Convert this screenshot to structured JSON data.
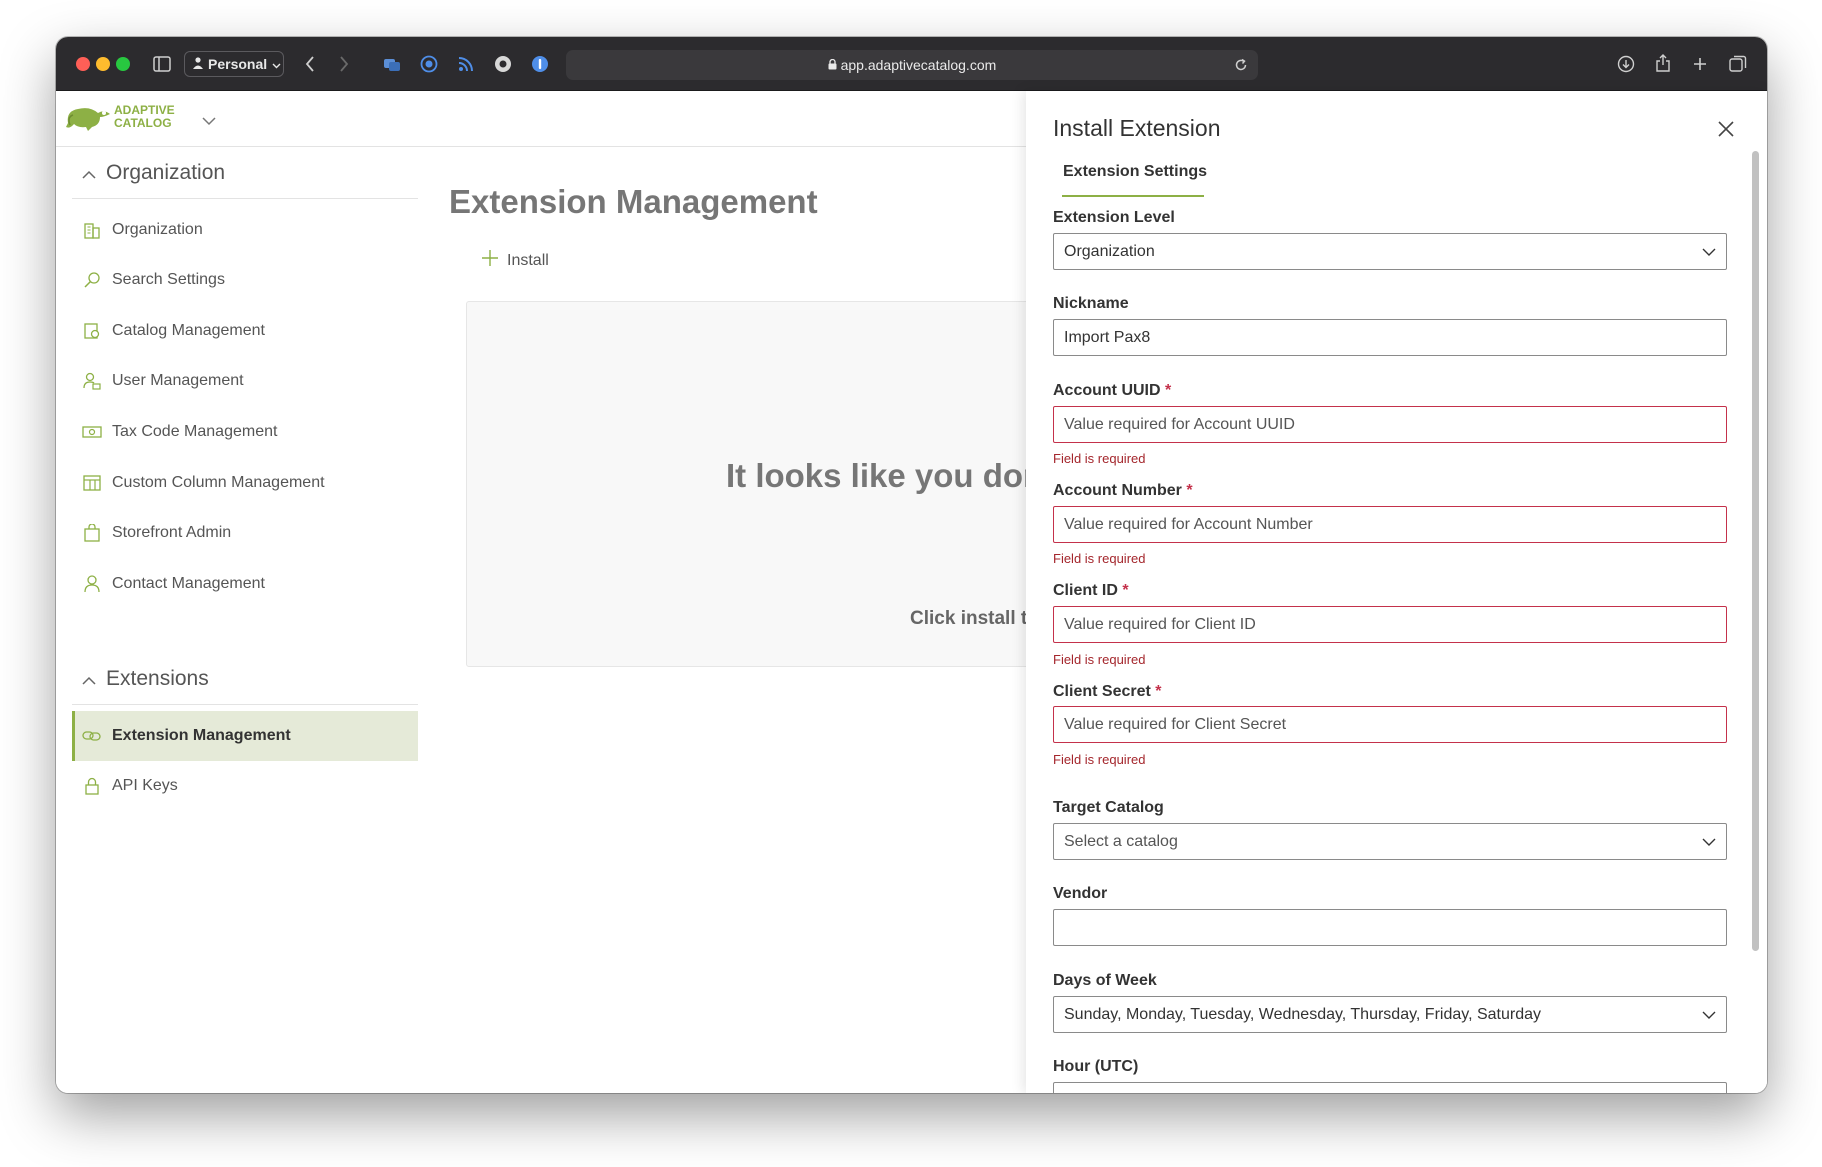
{
  "browser": {
    "profile": "Personal",
    "url": "app.adaptivecatalog.com"
  },
  "app": {
    "logo_line1": "ADAPTIVE",
    "logo_line2": "CATALOG"
  },
  "sidebar": {
    "sections": [
      {
        "title": "Organization",
        "items": [
          {
            "label": "Organization",
            "icon": "building-icon"
          },
          {
            "label": "Search Settings",
            "icon": "search-icon"
          },
          {
            "label": "Catalog Management",
            "icon": "catalog-icon"
          },
          {
            "label": "User Management",
            "icon": "user-settings-icon"
          },
          {
            "label": "Tax Code Management",
            "icon": "money-icon"
          },
          {
            "label": "Custom Column Management",
            "icon": "table-icon"
          },
          {
            "label": "Storefront Admin",
            "icon": "shopping-bag-icon"
          },
          {
            "label": "Contact Management",
            "icon": "person-icon"
          }
        ]
      },
      {
        "title": "Extensions",
        "items": [
          {
            "label": "Extension Management",
            "icon": "link-icon",
            "active": true
          },
          {
            "label": "API Keys",
            "icon": "lock-icon"
          }
        ]
      }
    ]
  },
  "main": {
    "title": "Extension Management",
    "install_label": "Install",
    "empty_title": "It looks like you don't",
    "empty_sub": "Click install to"
  },
  "panel": {
    "title": "Install Extension",
    "tab": "Extension Settings",
    "fields": {
      "extension_level": {
        "label": "Extension Level",
        "value": "Organization"
      },
      "nickname": {
        "label": "Nickname",
        "value": "Import Pax8"
      },
      "account_uuid": {
        "label": "Account UUID",
        "required": "*",
        "placeholder": "Value required for Account UUID",
        "error": "Field is required"
      },
      "account_number": {
        "label": "Account Number",
        "required": "*",
        "placeholder": "Value required for Account Number",
        "error": "Field is required"
      },
      "client_id": {
        "label": "Client ID",
        "required": "*",
        "placeholder": "Value required for Client ID",
        "error": "Field is required"
      },
      "client_secret": {
        "label": "Client Secret",
        "required": "*",
        "placeholder": "Value required for Client Secret",
        "error": "Field is required"
      },
      "target_catalog": {
        "label": "Target Catalog",
        "placeholder": "Select a catalog"
      },
      "vendor": {
        "label": "Vendor",
        "value": ""
      },
      "days_of_week": {
        "label": "Days of Week",
        "value": "Sunday, Monday, Tuesday, Wednesday, Thursday, Friday, Saturday"
      },
      "hour_utc": {
        "label": "Hour (UTC)"
      }
    }
  },
  "colors": {
    "accent": "#8db045",
    "error": "#c4314b",
    "active_bg": "#e5ead8"
  }
}
